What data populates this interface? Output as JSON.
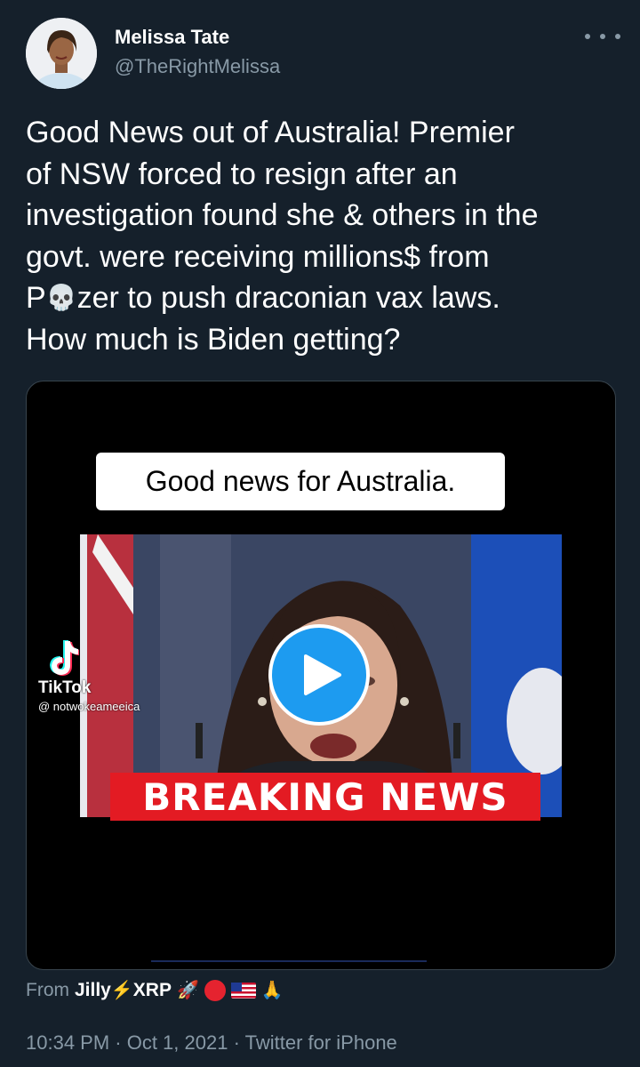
{
  "author": {
    "display_name": "Melissa Tate",
    "handle": "@TheRightMelissa"
  },
  "tweet": {
    "lines": [
      "Good News out of Australia! Premier",
      "of NSW forced to resign after an",
      "investigation found she & others in the",
      "govt. were receiving millions$ from",
      "zer to push draconian vax laws.",
      "How much is Biden getting?"
    ],
    "line5_prefix": "P",
    "skull_emoji": "💀"
  },
  "media": {
    "caption": "Good news for Australia.",
    "banner": "BREAKING NEWS",
    "watermark_app": "TikTok",
    "watermark_user": "@ notwokeameeica",
    "play_color": "#1d9bf0",
    "banner_color": "#e31b23"
  },
  "source": {
    "prefix": "From",
    "app_name": "Jilly",
    "app_suffix": "XRP",
    "emojis": [
      "⚡",
      "🚀",
      "🙏"
    ]
  },
  "meta": {
    "timestamp": "10:34 PM · Oct 1, 2021 · Twitter for iPhone"
  },
  "colors": {
    "background": "#15202b",
    "muted_text": "#8899a6"
  }
}
